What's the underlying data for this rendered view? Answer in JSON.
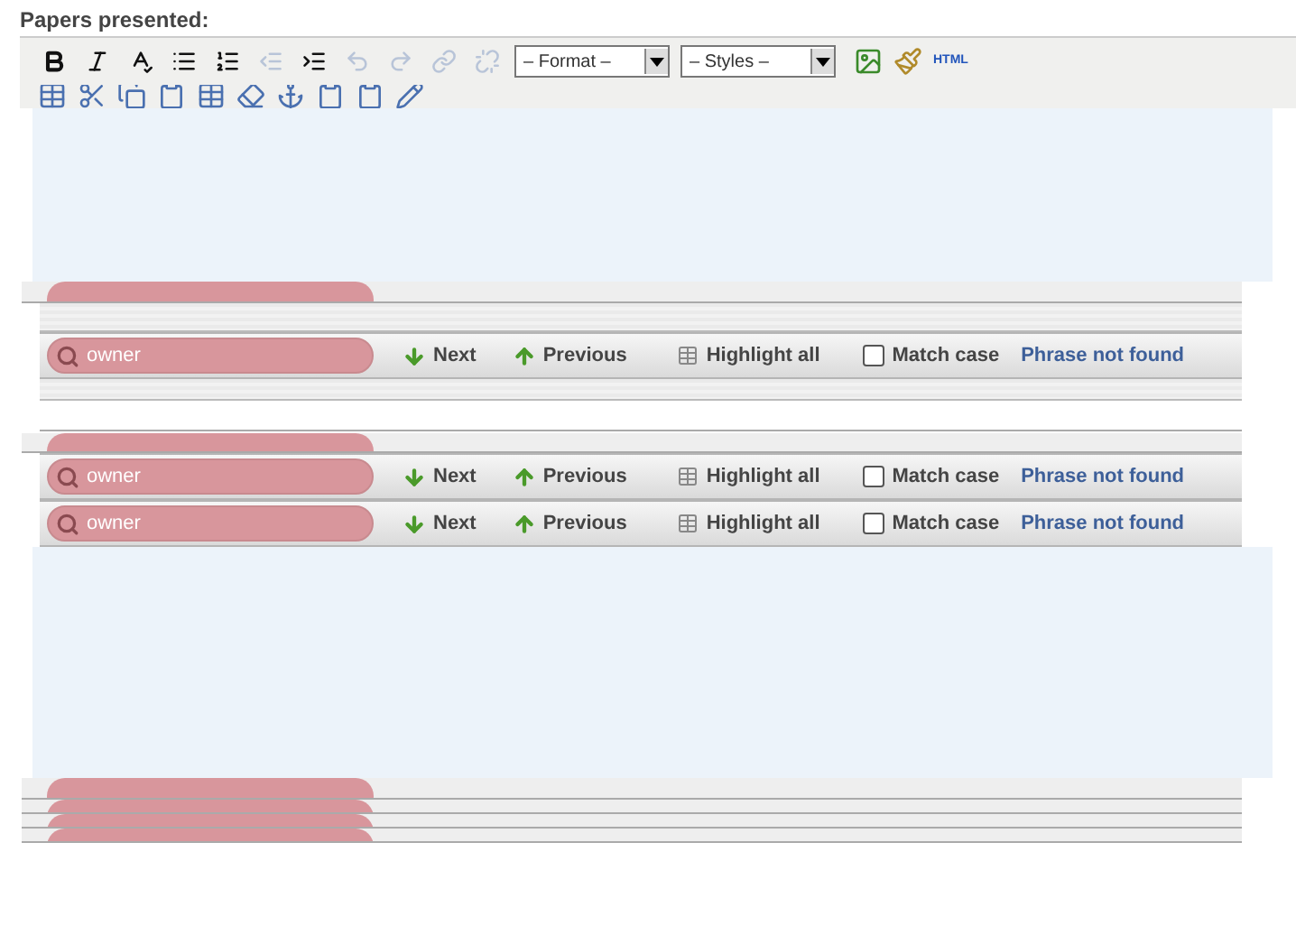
{
  "title": "Papers presented:",
  "toolbar": {
    "buttons": [
      {
        "kind": "bold",
        "disabled": false
      },
      {
        "kind": "italic",
        "disabled": false
      },
      {
        "kind": "spellcheck",
        "disabled": false
      },
      {
        "kind": "bullets",
        "disabled": false
      },
      {
        "kind": "numbers",
        "disabled": false
      },
      {
        "kind": "outdent",
        "disabled": true
      },
      {
        "kind": "indent",
        "disabled": false
      },
      {
        "kind": "undo",
        "disabled": true
      },
      {
        "kind": "redo",
        "disabled": true
      },
      {
        "kind": "link",
        "disabled": true
      },
      {
        "kind": "unlink",
        "disabled": true
      }
    ],
    "format_select": "– Format –",
    "styles_select": "– Styles –",
    "html_button": "HTML"
  },
  "find_bars": [
    {
      "query": "owner",
      "next": "Next",
      "previous": "Previous",
      "highlight_all": "Highlight all",
      "match_case": {
        "label": "Match case",
        "checked": false
      },
      "status": "Phrase not found"
    },
    {
      "query": "owner",
      "next": "Next",
      "previous": "Previous",
      "highlight_all": "Highlight all",
      "match_case": {
        "label": "Match case",
        "checked": false
      },
      "status": "Phrase not found"
    },
    {
      "query": "owner",
      "next": "Next",
      "previous": "Previous",
      "highlight_all": "Highlight all",
      "match_case": {
        "label": "Match case",
        "checked": false
      },
      "status": "Phrase not found"
    }
  ]
}
